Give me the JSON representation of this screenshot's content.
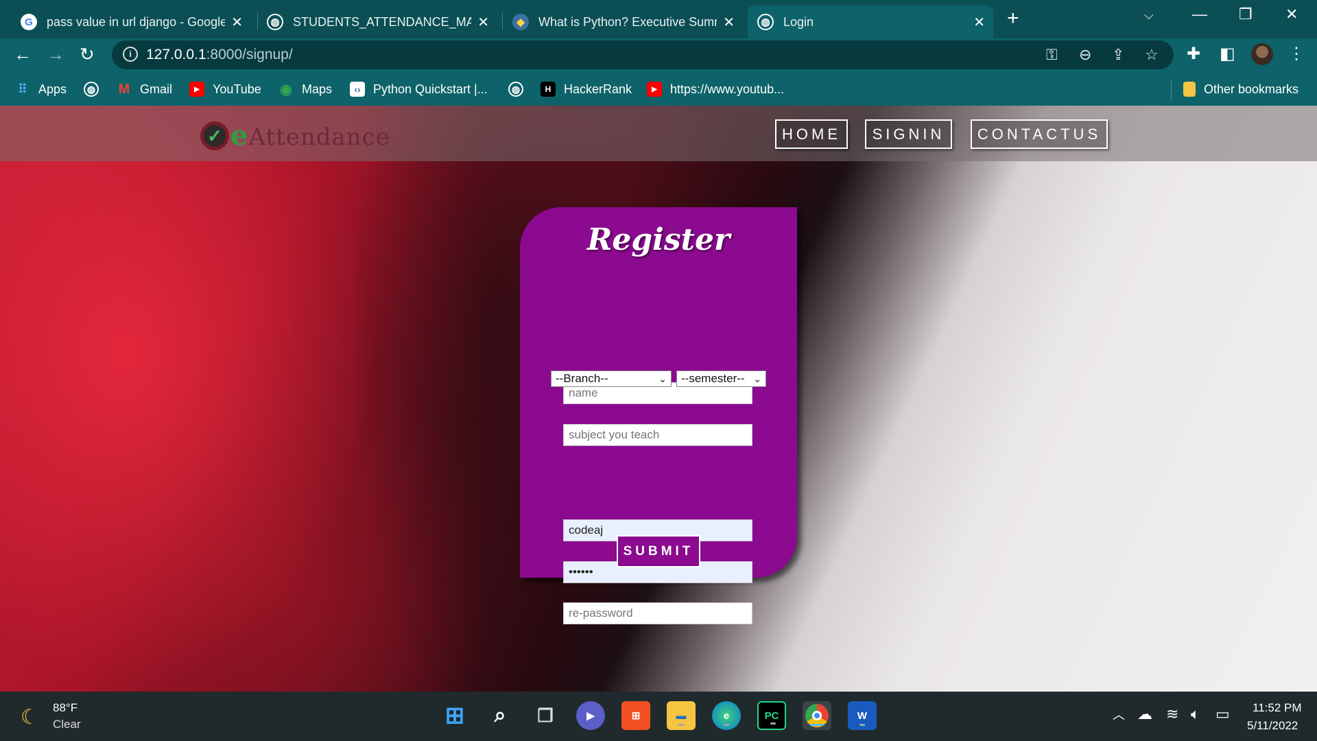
{
  "browser": {
    "tabs": [
      {
        "title": "pass value in url django - Google",
        "favicon": "google-icon"
      },
      {
        "title": "STUDENTS_ATTENDANCE_MANA",
        "favicon": "globe-icon"
      },
      {
        "title": "What is Python? Executive Summ",
        "favicon": "python-icon"
      },
      {
        "title": "Login",
        "favicon": "globe-icon",
        "active": true
      }
    ],
    "url_host": "127.0.0.1",
    "url_path": ":8000/signup/",
    "bookmarks": [
      {
        "label": "Apps",
        "icon": "apps-grid-icon"
      },
      {
        "label": "",
        "icon": "globe-icon"
      },
      {
        "label": "Gmail",
        "icon": "gmail-icon"
      },
      {
        "label": "YouTube",
        "icon": "youtube-icon"
      },
      {
        "label": "Maps",
        "icon": "maps-icon"
      },
      {
        "label": "Python Quickstart |...",
        "icon": "python-quickstart-icon"
      },
      {
        "label": "",
        "icon": "globe-icon"
      },
      {
        "label": "HackerRank",
        "icon": "hackerrank-icon"
      },
      {
        "label": "https://www.youtub...",
        "icon": "youtube-icon"
      }
    ],
    "other_bookmarks": "Other bookmarks"
  },
  "site": {
    "logo_text_e": "e",
    "logo_text_rest": "Attendance",
    "nav": {
      "home": "HOME",
      "signin": "SIGNIN",
      "contactus": "CONTACTUS"
    }
  },
  "register": {
    "title": "Register",
    "name_placeholder": "name",
    "subject_placeholder": "subject you teach",
    "branch_selected": "--Branch--",
    "semester_selected": "--semester--",
    "username_value": "codeaj",
    "password_value": "••••••",
    "repassword_placeholder": "re-password",
    "submit_label": "SUBMIT"
  },
  "taskbar": {
    "weather_temp": "88°F",
    "weather_condition": "Clear",
    "time": "11:52 PM",
    "date": "5/11/2022"
  },
  "colors": {
    "chrome_dark": "#0b4f55",
    "chrome": "#0e6269",
    "form_purple": "#8b0a8f"
  }
}
